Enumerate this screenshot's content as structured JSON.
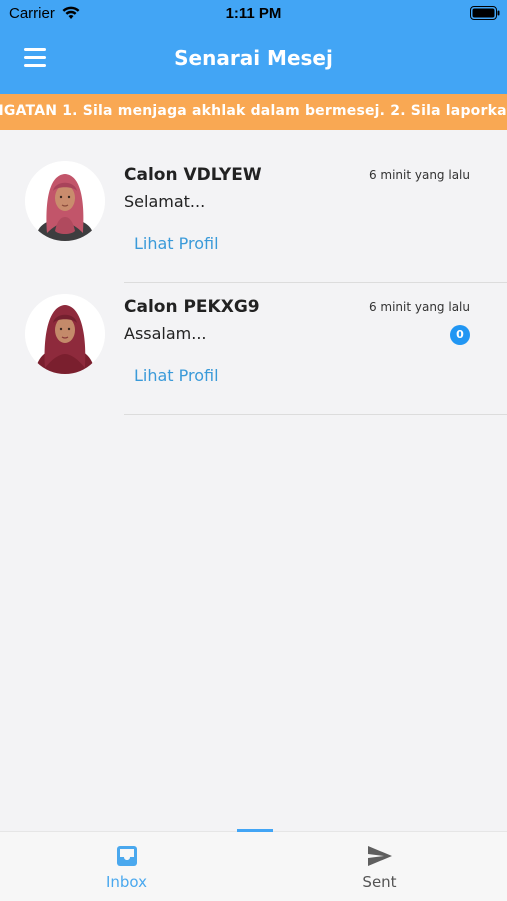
{
  "status_bar": {
    "carrier": "Carrier",
    "time": "1:11 PM"
  },
  "app_bar": {
    "title": "Senarai Mesej",
    "menu_icon": "hamburger-menu-icon"
  },
  "notice": {
    "text": "NGATAN    1. Sila menjaga akhlak dalam bermesej.    2. Sila laporka"
  },
  "messages": [
    {
      "name": "Calon VDLYEW",
      "time": "6 minit yang lalu",
      "preview": "Selamat...",
      "link": "Lihat Profil",
      "badge": ""
    },
    {
      "name": "Calon PEKXG9",
      "time": "6 minit yang lalu",
      "preview": "Assalam...",
      "link": "Lihat Profil",
      "badge": "0"
    }
  ],
  "bottom_nav": [
    {
      "label": "Inbox",
      "icon": "inbox-icon",
      "active": true
    },
    {
      "label": "Sent",
      "icon": "send-icon",
      "active": false
    }
  ],
  "colors": {
    "primary": "#42a5f5",
    "notice": "#f9a853",
    "link": "#3a9ad9",
    "badge": "#2196f3"
  }
}
